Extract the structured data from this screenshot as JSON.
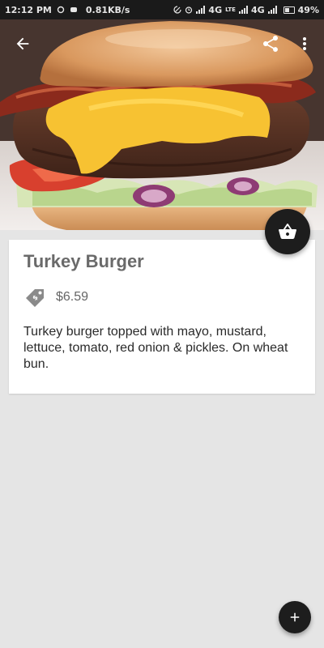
{
  "status_bar": {
    "time": "12:12 PM",
    "network_speed": "0.81KB/s",
    "network_1": "4G",
    "network_1_sub": "LTE",
    "network_2": "4G",
    "battery": "49%"
  },
  "product": {
    "name": "Turkey Burger",
    "price": "$6.59",
    "description": "Turkey burger topped with mayo, mustard, lettuce, tomato, red onion & pickles. On wheat bun."
  },
  "icons": {
    "back": "arrow-back-icon",
    "share": "share-icon",
    "more": "more-vert-icon",
    "cart": "basket-icon",
    "add": "plus-icon",
    "price_tag": "price-tag-icon"
  },
  "colors": {
    "background": "#e5e5e5",
    "card": "#ffffff",
    "fab": "#1d1d1d",
    "title": "#6a6a6a"
  }
}
